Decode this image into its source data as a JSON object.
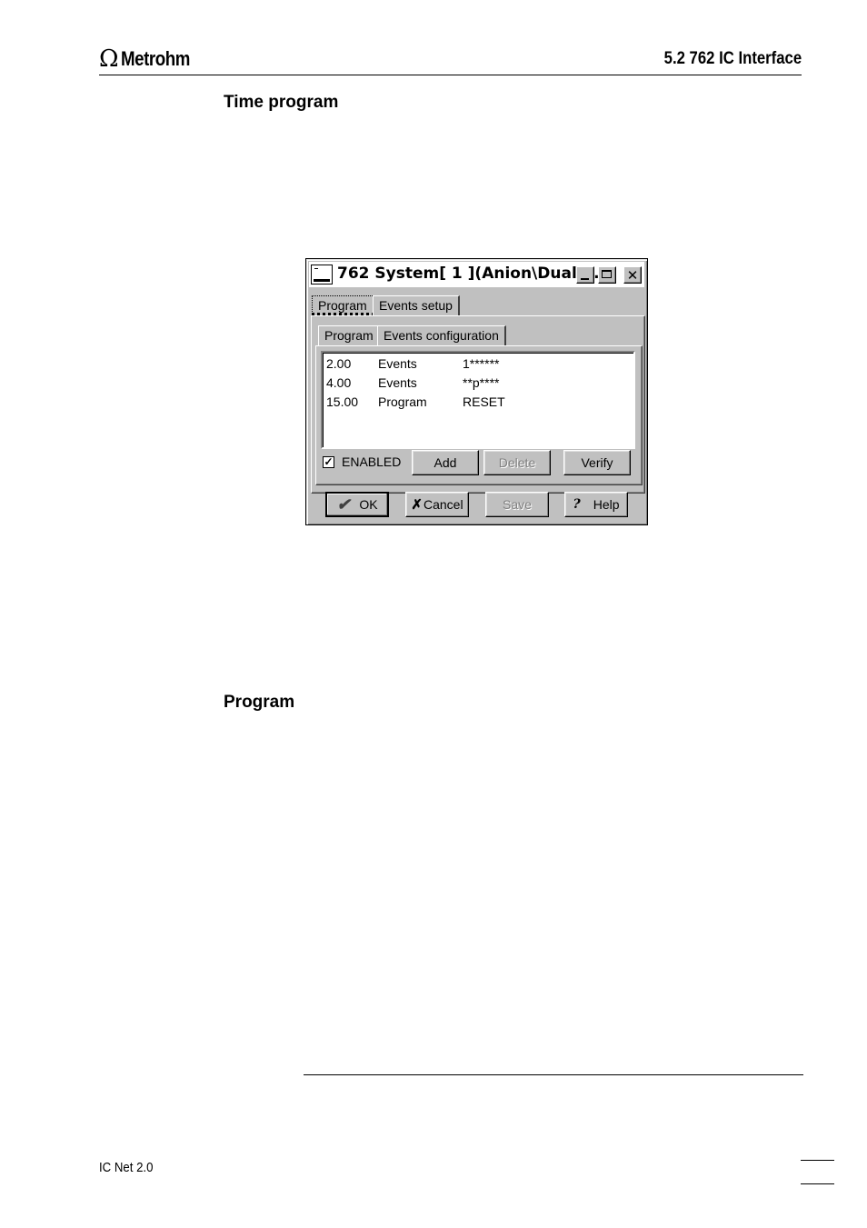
{
  "header": {
    "brand": "Metrohm",
    "section_title": "5.2  762 IC Interface"
  },
  "headings": {
    "time_program": "Time program",
    "program": "Program"
  },
  "dialog": {
    "title": "762 System[ 1 ](Anion\\Dual2...",
    "outer_tabs": [
      "Program",
      "Events setup"
    ],
    "inner_tabs": [
      "Program",
      "Events configuration"
    ],
    "list": [
      {
        "time": "2.00",
        "type": "Events",
        "value": "1******"
      },
      {
        "time": "4.00",
        "type": "Events",
        "value": "**p****"
      },
      {
        "time": "15.00",
        "type": "Program",
        "value": "RESET"
      }
    ],
    "enabled_label": "ENABLED",
    "enabled_checked": true,
    "buttons": {
      "add": "Add",
      "delete": "Delete",
      "verify": "Verify",
      "ok": "OK",
      "cancel": "Cancel",
      "save": "Save",
      "help": "Help"
    }
  },
  "footer": {
    "text": "IC Net 2.0"
  }
}
